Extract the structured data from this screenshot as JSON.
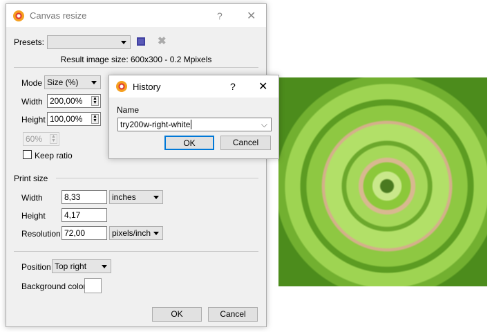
{
  "main": {
    "title": "Canvas resize",
    "help": "?",
    "close": "✕",
    "presets_label": "Presets:",
    "presets_value": "",
    "result_size": "Result image size: 600x300 - 0.2 Mpixels",
    "mode_label": "Mode",
    "mode_value": "Size (%)",
    "width_label": "Width",
    "width_value": "200,00%",
    "height_label": "Height",
    "height_value": "100,00%",
    "ratio_value": "60%",
    "keep_ratio_label": "Keep ratio",
    "print_size_label": "Print size",
    "print_width_label": "Width",
    "print_width_value": "8,33",
    "print_width_unit": "inches",
    "print_height_label": "Height",
    "print_height_value": "4,17",
    "resolution_label": "Resolution",
    "resolution_value": "72,00",
    "resolution_unit": "pixels/inch",
    "position_label": "Position",
    "position_value": "Top right",
    "bg_color_label": "Background color",
    "bg_color": "#ffffff",
    "ok": "OK",
    "cancel": "Cancel"
  },
  "history": {
    "title": "History",
    "help": "?",
    "close": "✕",
    "name_label": "Name",
    "name_value": "try200w-right-white",
    "ok": "OK",
    "cancel": "Cancel"
  }
}
